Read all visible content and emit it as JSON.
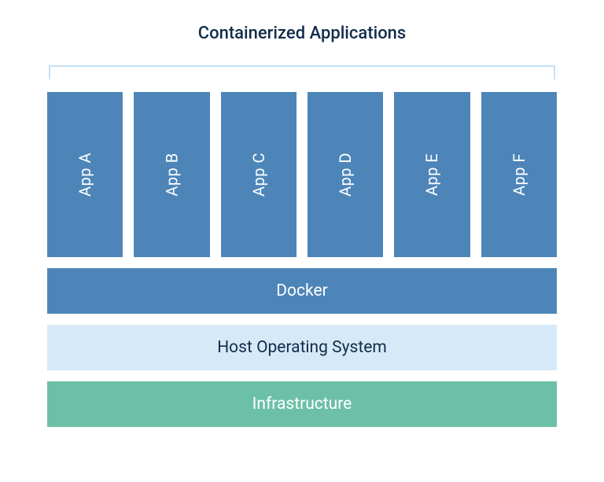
{
  "title": "Containerized Applications",
  "apps": {
    "a": "App A",
    "b": "App B",
    "c": "App C",
    "d": "App D",
    "e": "App E",
    "f": "App F"
  },
  "layers": {
    "docker": "Docker",
    "host": "Host Operating System",
    "infra": "Infrastructure"
  },
  "colors": {
    "app_bg": "#4d85b9",
    "host_bg": "#d6e9f8",
    "infra_bg": "#6cc0a7",
    "text_dark": "#122c4a",
    "bracket": "#c6e1f5"
  }
}
